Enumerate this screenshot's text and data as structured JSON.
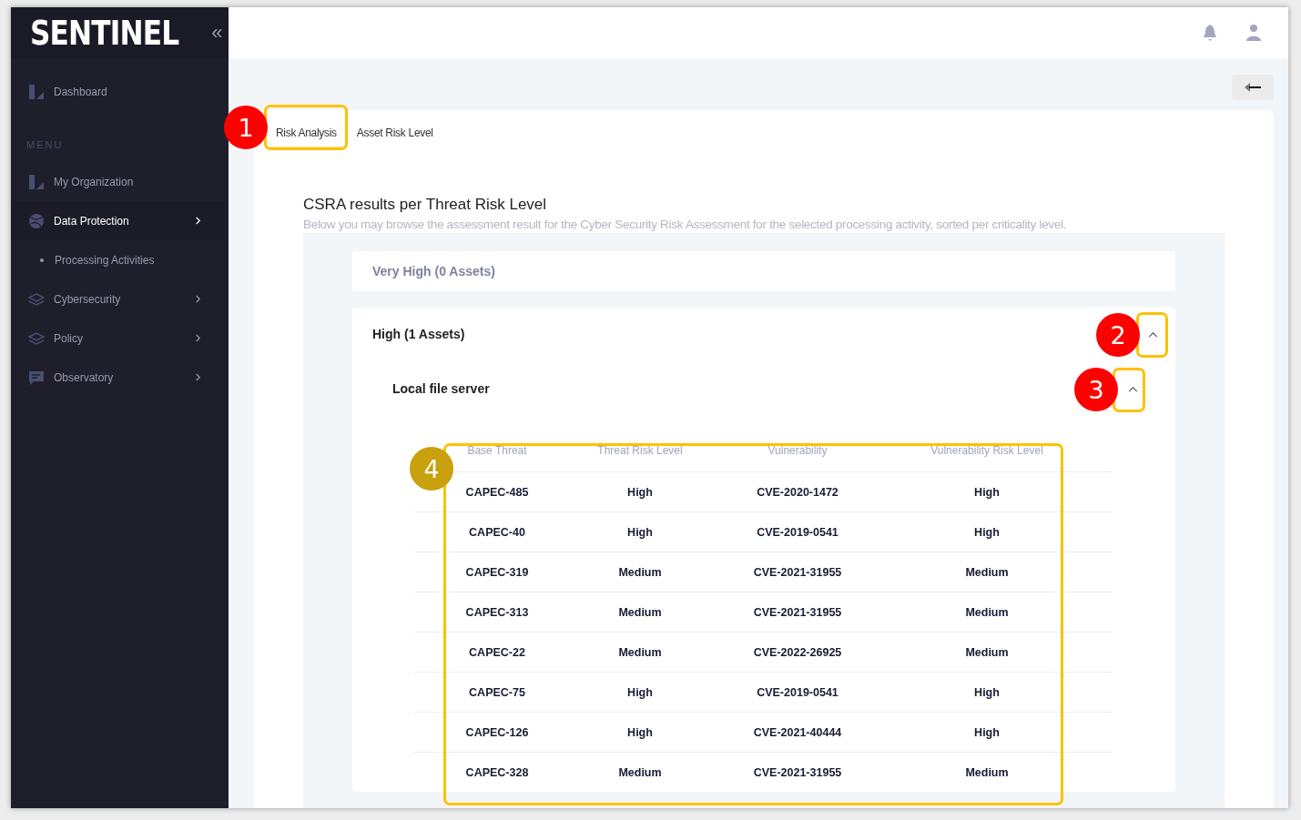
{
  "sidebar": {
    "logo": "SENTINEL",
    "collapse": "«",
    "items": [
      {
        "kind": "item",
        "label": "Dashboard",
        "selected": false,
        "expandable": false
      },
      {
        "kind": "section",
        "label": "MENU"
      },
      {
        "kind": "item",
        "label": "My Organization",
        "selected": false,
        "expandable": false
      },
      {
        "kind": "item",
        "label": "Data Protection",
        "selected": true,
        "expandable": true
      },
      {
        "kind": "subitem",
        "label": "Processing Activities",
        "selected": false
      },
      {
        "kind": "item",
        "label": "Cybersecurity",
        "selected": false,
        "expandable": true
      },
      {
        "kind": "item",
        "label": "Policy",
        "selected": false,
        "expandable": true
      },
      {
        "kind": "item",
        "label": "Observatory",
        "selected": false,
        "expandable": true
      }
    ]
  },
  "tabs": [
    {
      "label": "Risk Analysis",
      "selected": true
    },
    {
      "label": "Asset Risk Level",
      "selected": false
    }
  ],
  "title": "CSRA results per Threat Risk Level",
  "subtitle": "Below you may browse the assessment result for the Cyber Security Risk Assessment for the selected processing activity, sorted per criticality level.",
  "groups": [
    {
      "label": "Very High (0 Assets)",
      "expanded": false
    },
    {
      "label": "High (1 Assets)",
      "expanded": true,
      "assets": [
        {
          "name": "Local file server",
          "expanded": true,
          "columns": [
            "Base Threat",
            "Threat Risk Level",
            "Vulnerability",
            "Vulnerability Risk Level"
          ],
          "rows": [
            [
              "CAPEC-485",
              "High",
              "CVE-2020-1472",
              "High"
            ],
            [
              "CAPEC-40",
              "High",
              "CVE-2019-0541",
              "High"
            ],
            [
              "CAPEC-319",
              "Medium",
              "CVE-2021-31955",
              "Medium"
            ],
            [
              "CAPEC-313",
              "Medium",
              "CVE-2021-31955",
              "Medium"
            ],
            [
              "CAPEC-22",
              "Medium",
              "CVE-2022-26925",
              "Medium"
            ],
            [
              "CAPEC-75",
              "High",
              "CVE-2019-0541",
              "High"
            ],
            [
              "CAPEC-126",
              "High",
              "CVE-2021-40444",
              "High"
            ],
            [
              "CAPEC-328",
              "Medium",
              "CVE-2021-31955",
              "Medium"
            ]
          ]
        }
      ]
    }
  ],
  "callouts": [
    {
      "number": "1",
      "color": "#ff0000"
    },
    {
      "number": "2",
      "color": "#ff0000"
    },
    {
      "number": "3",
      "color": "#ff0000"
    },
    {
      "number": "4",
      "color": "#c9a00d"
    }
  ]
}
